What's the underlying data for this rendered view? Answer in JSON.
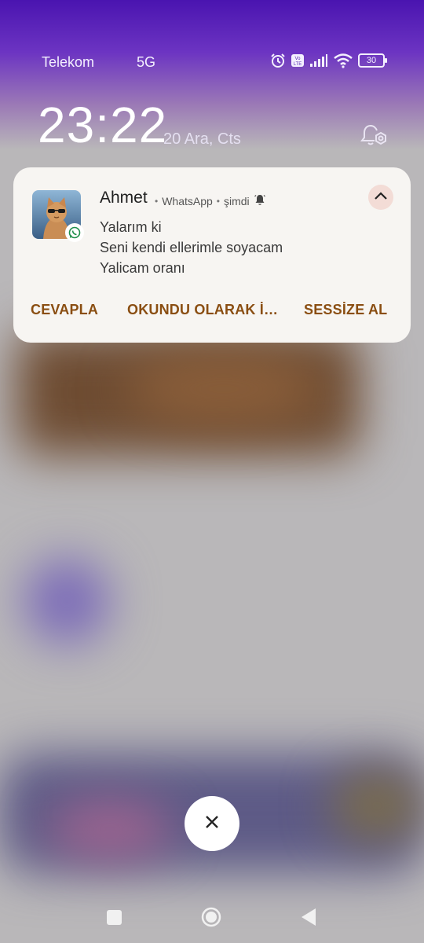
{
  "status_bar": {
    "carrier": "Telekom",
    "network": "5G",
    "battery": "30",
    "volte": "Vo LTE"
  },
  "lockscreen": {
    "time": "23:22",
    "date": "20 Ara, Cts"
  },
  "notification": {
    "sender": "Ahmet",
    "app": "WhatsApp",
    "time": "şimdi",
    "messages": [
      "Yalarım ki",
      "Seni kendi ellerimle soyacam",
      "Yalicam oranı"
    ],
    "actions": [
      "CEVAPLA",
      "OKUNDU OLARAK İ…",
      "SESSİZE AL"
    ],
    "accent_color": "#8a4e12",
    "whatsapp_color": "#25d366"
  },
  "icons": {
    "alarm": "alarm-icon",
    "signal": "signal-icon",
    "wifi": "wifi-icon",
    "bell_settings": "notification-settings-icon",
    "collapse": "chevron-up-icon",
    "close": "close-icon"
  }
}
